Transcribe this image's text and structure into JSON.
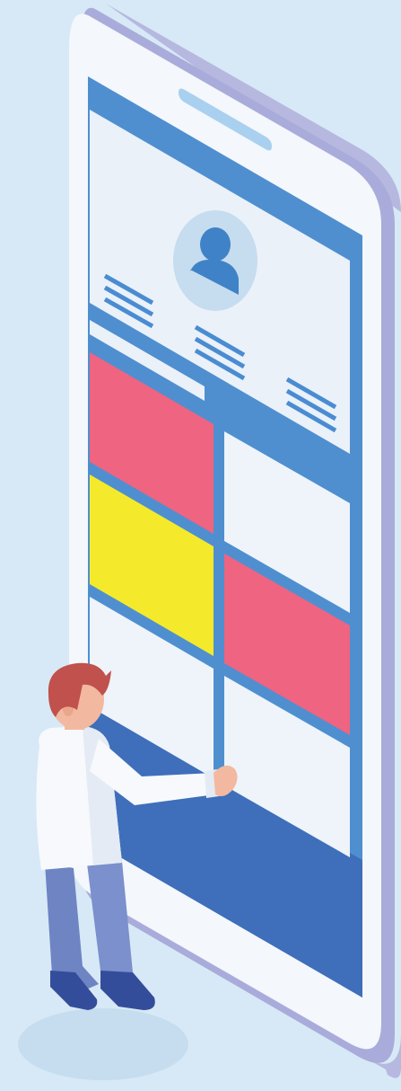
{
  "colors": {
    "background": "#d7e9f6",
    "phone_body": "#f4f7fb",
    "phone_edge": "#b7b8e0",
    "phone_edge_dark": "#9fa3d4",
    "screen_frame": "#4f8fd0",
    "screen_bottom": "#3f6fba",
    "panel": "#eaf1f9",
    "speaker": "#a9d0ef",
    "avatar_ring": "#c6dcef",
    "avatar_person": "#3f82c7",
    "text_lines": "#4a8cd2",
    "tile_pink": "#ef6480",
    "tile_yellow": "#f4ea2b",
    "tile_white": "#eef4fa",
    "skin": "#f2b9a0",
    "hair": "#c0514c",
    "shirt": "#f7f9fc",
    "pants": "#6f84c3",
    "shoes": "#344d9b",
    "shadow": "#c5ddef"
  },
  "icons": {
    "profile": "user-avatar-icon",
    "text_block": "text-lines-icon"
  },
  "tiles": [
    {
      "name": "tile-top-left",
      "color": "pink"
    },
    {
      "name": "tile-top-right",
      "color": "white"
    },
    {
      "name": "tile-mid-left",
      "color": "yellow"
    },
    {
      "name": "tile-mid-right",
      "color": "pink"
    },
    {
      "name": "tile-bottom-left",
      "color": "white"
    },
    {
      "name": "tile-bottom-right",
      "color": "white"
    }
  ]
}
